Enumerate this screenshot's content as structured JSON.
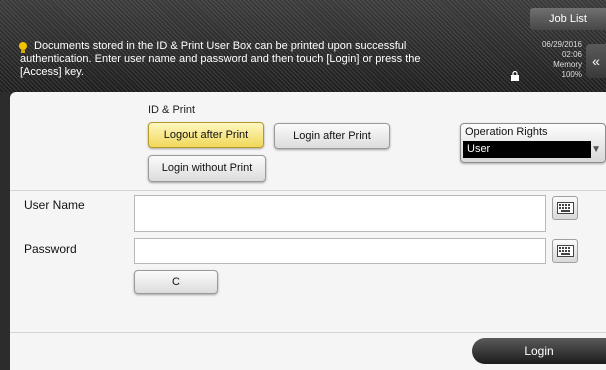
{
  "header": {
    "job_list_label": "Job List",
    "message": "Documents stored in the ID & Print User Box can be printed upon successful authentication. Enter user name and password and then touch [Login] or press the [Access] key.",
    "date": "06/29/2016",
    "time": "02:06",
    "memory_label": "Memory",
    "memory_value": "100%"
  },
  "id_print": {
    "section_label": "ID & Print",
    "logout_after_print": "Logout after Print",
    "login_after_print": "Login after Print",
    "login_without_print": "Login without Print"
  },
  "operation_rights": {
    "title": "Operation Rights",
    "value": "User"
  },
  "form": {
    "user_name_label": "User Name",
    "user_name_value": "",
    "password_label": "Password",
    "password_value": "",
    "clear_label": "C"
  },
  "footer": {
    "login_label": "Login"
  },
  "colors": {
    "selected_button": "#f0d85a",
    "header_background": "#2a2a2a"
  }
}
